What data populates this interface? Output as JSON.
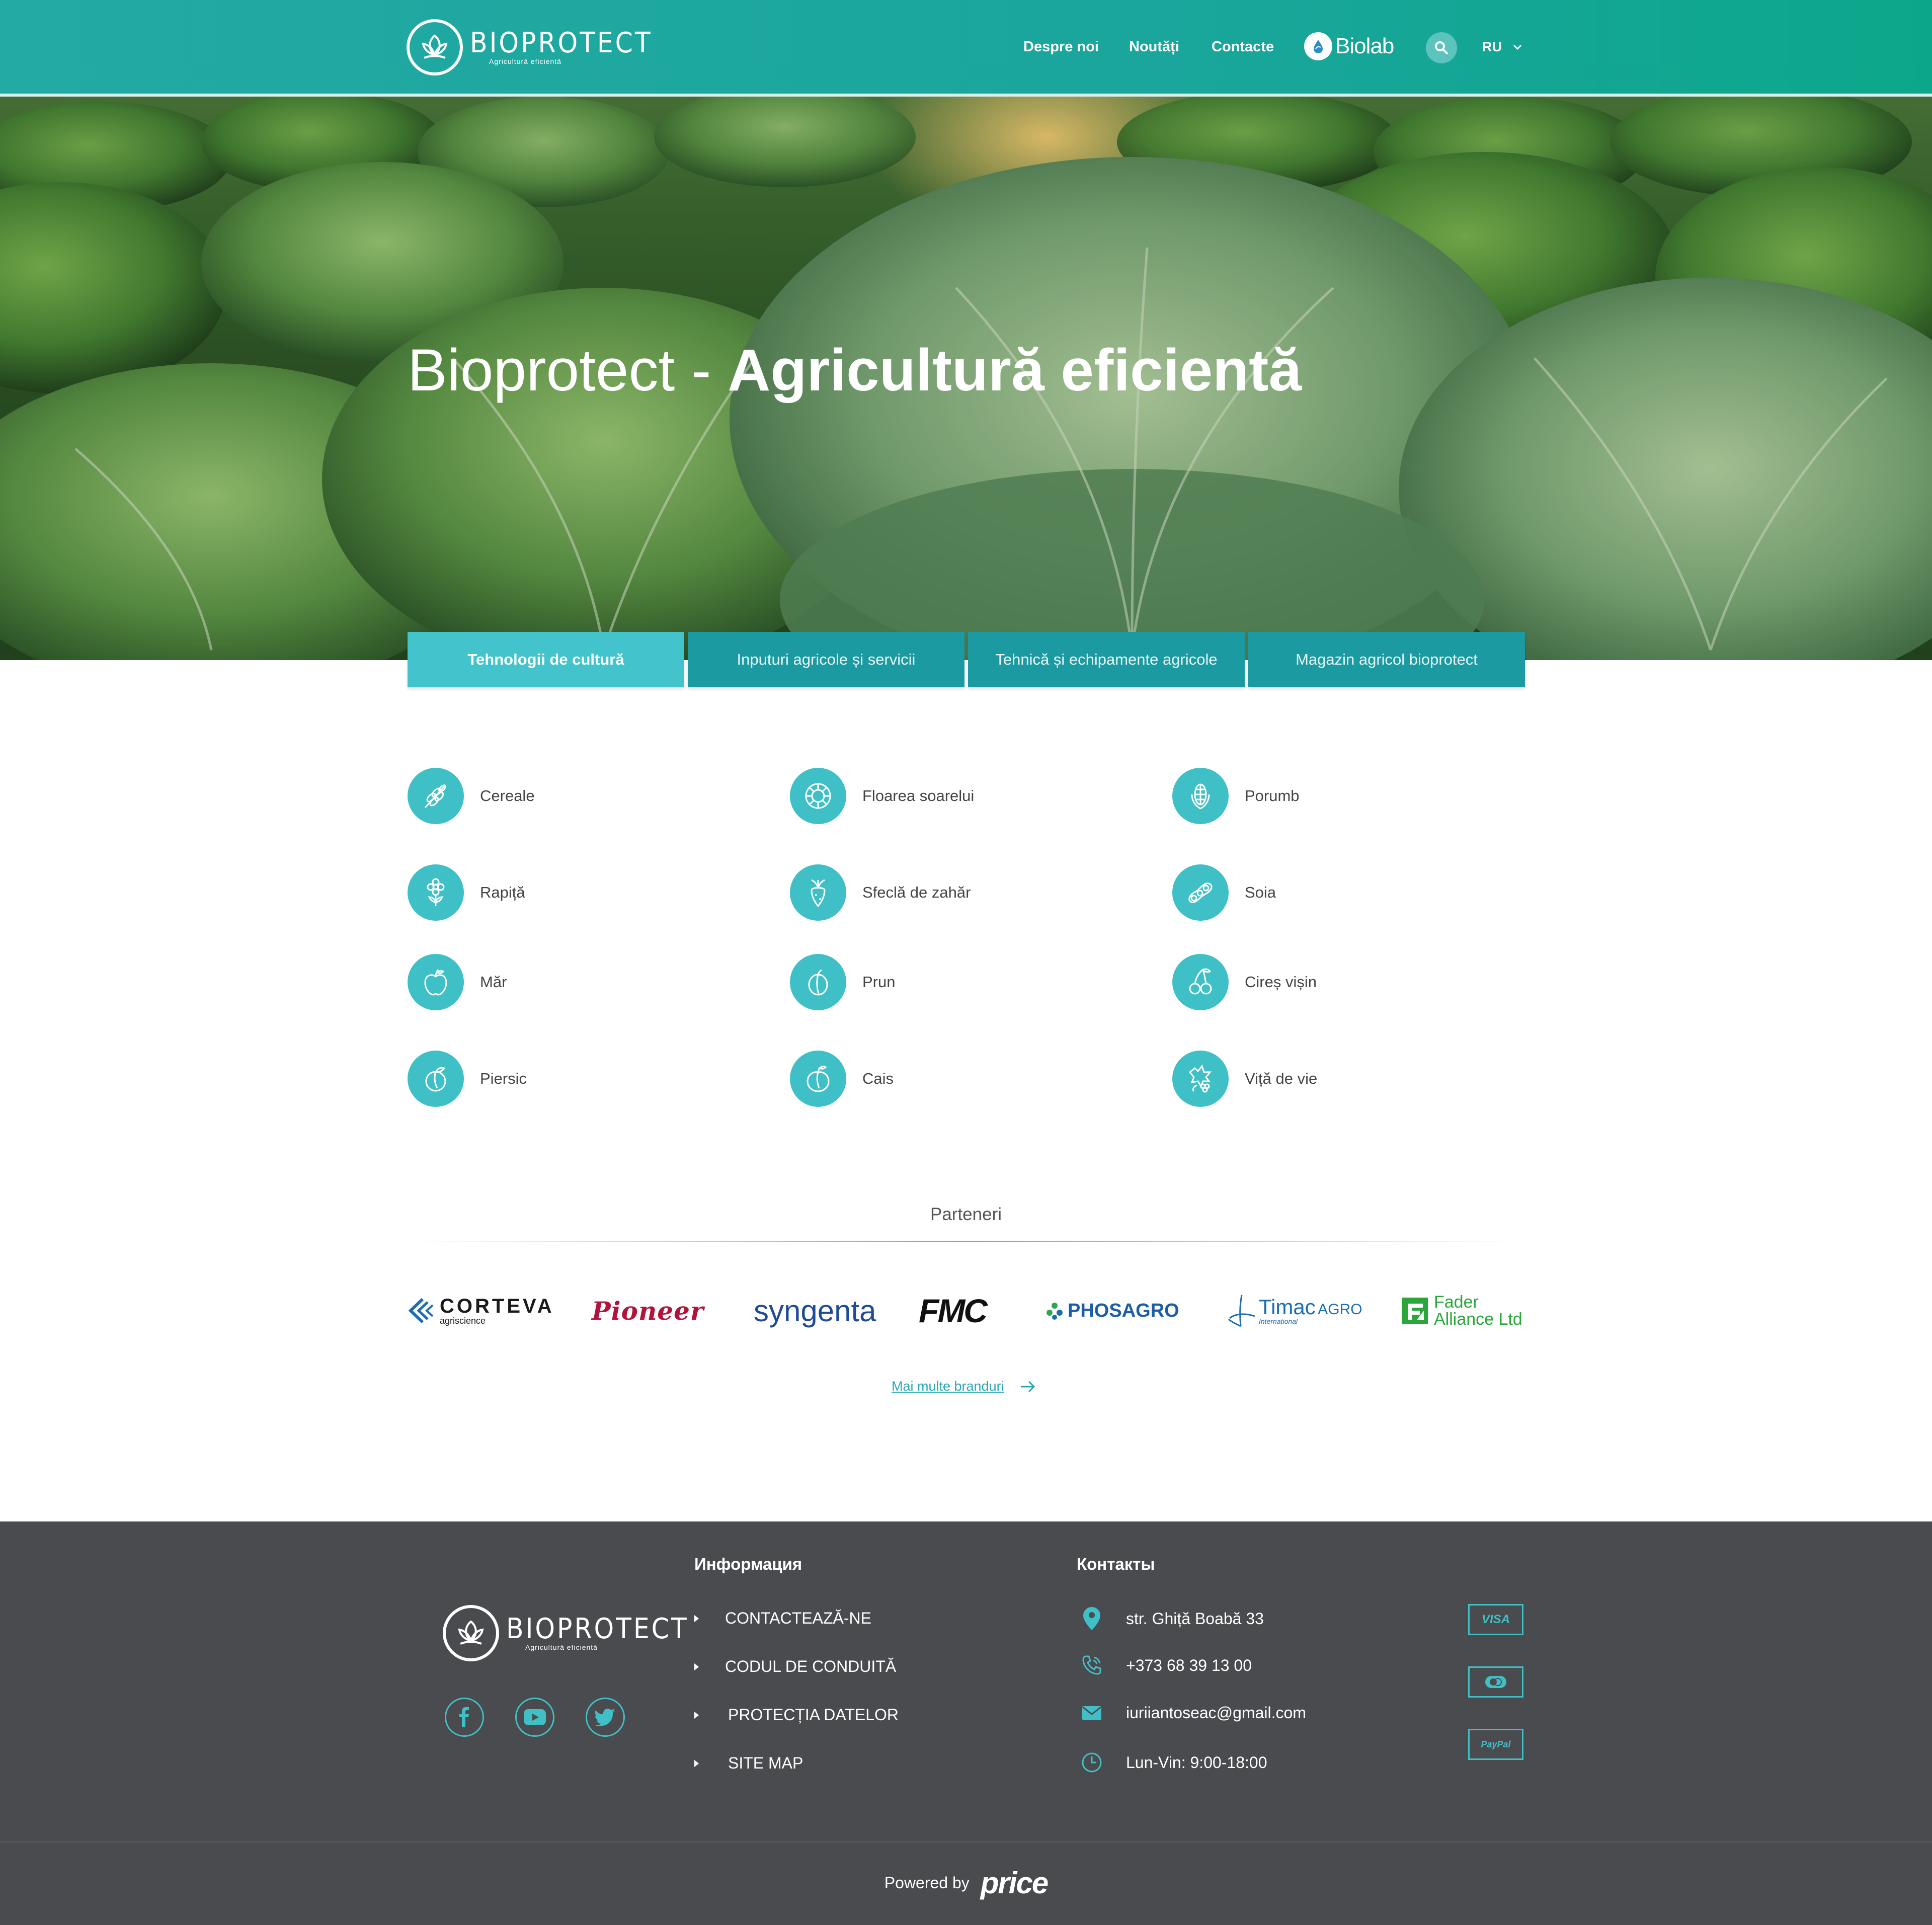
{
  "header": {
    "logo_name": "BIOPROTECT",
    "logo_tagline": "Agricultură eficientă",
    "nav": [
      "Despre noi",
      "Noutăți",
      "Contacte"
    ],
    "biolab": "Biolab",
    "lang": "RU"
  },
  "hero": {
    "title_light": "Bioprotect - ",
    "title_bold": "Agricultură eficientă"
  },
  "tabs": [
    {
      "label": "Tehnologii de cultură",
      "active": true
    },
    {
      "label": "Inputuri agricole și servicii",
      "active": false
    },
    {
      "label": "Tehnică și echipamente agricole",
      "active": false
    },
    {
      "label": "Magazin agricol bioprotect",
      "active": false
    }
  ],
  "crops": [
    {
      "label": "Cereale",
      "icon": "wheat-icon"
    },
    {
      "label": "Floarea soarelui",
      "icon": "sunflower-icon"
    },
    {
      "label": "Porumb",
      "icon": "corn-icon"
    },
    {
      "label": "Rapiță",
      "icon": "rapeseed-flower-icon"
    },
    {
      "label": "Sfeclă de zahăr",
      "icon": "sugar-beet-icon"
    },
    {
      "label": "Soia",
      "icon": "soy-pod-icon"
    },
    {
      "label": "Măr",
      "icon": "apple-icon"
    },
    {
      "label": "Prun",
      "icon": "plum-icon"
    },
    {
      "label": "Cireș vișin",
      "icon": "cherry-icon"
    },
    {
      "label": "Piersic",
      "icon": "peach-icon"
    },
    {
      "label": "Cais",
      "icon": "apricot-icon"
    },
    {
      "label": "Viță de vie",
      "icon": "grape-vine-icon"
    }
  ],
  "partners": {
    "title": "Parteneri",
    "brands": {
      "corteva": "CORTEVA",
      "corteva_sub": "agriscience",
      "pioneer": "Pioneer",
      "syngenta": "syngenta",
      "fmc": "FMC",
      "phosagro": "PHOSAGRO",
      "timac": "Timac",
      "timac_agro": "AGRO",
      "timac_sub": "International",
      "fader_1": "Fader",
      "fader_2": "Alliance Ltd"
    },
    "more_link": "Mai multe branduri"
  },
  "footer": {
    "info_heading": "Информация",
    "info_links": [
      "CONTACTEAZĂ-NE",
      "CODUL DE CONDUITĂ",
      "PROTECȚIA DATELOR",
      "SITE MAP"
    ],
    "contacts_heading": "Контакты",
    "address": "str. Ghiță Boabă 33",
    "phone": "+373 68 39 13 00",
    "email": "iuriiantoseac@gmail.com",
    "hours": "Lun-Vin: 9:00-18:00",
    "payments": [
      "VISA",
      "PayPal"
    ],
    "powered_by": "Powered by",
    "powered_brand": "price"
  },
  "colors": {
    "header": "#1aa69c",
    "accent": "#3fbfc6",
    "tab": "#1c9aa1",
    "tab_active": "#43c3cb",
    "footer": "#4a4b4f"
  }
}
